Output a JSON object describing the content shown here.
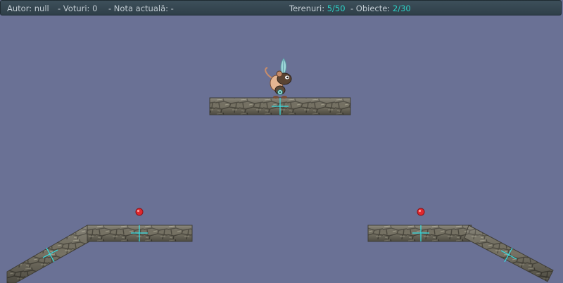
{
  "header": {
    "autor_label": "Autor:",
    "autor_value": "null",
    "voturi_label": "- Voturi:",
    "voturi_value": "0",
    "nota_label": "- Nota actuală:",
    "nota_value": "-",
    "terenuri_label": "Terenuri:",
    "terenuri_value": "5/50",
    "obiecte_label": "- Obiecte:",
    "obiecte_value": "2/30"
  },
  "colors": {
    "background": "#6a7195",
    "accent": "#2dd1c6",
    "crosshair": "#33e0e6",
    "stone": "#7b7768",
    "spawn_dot": "#e0282e"
  },
  "scene": {
    "grounds": [
      "stone-platform-top",
      "stone-platform-left",
      "stone-ramp-left",
      "stone-platform-right",
      "stone-ramp-right"
    ],
    "objects": [
      "spawn-point-left",
      "spawn-point-right"
    ],
    "player": "mouse-shaman-feather"
  }
}
